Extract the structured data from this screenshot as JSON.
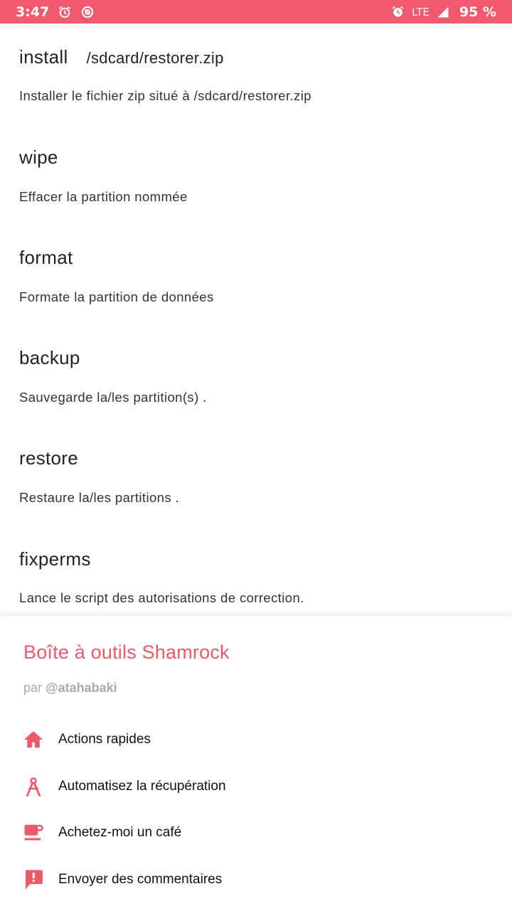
{
  "status_bar": {
    "time": "3:47",
    "network": "LTE",
    "battery": "95 %",
    "left_icons": [
      "alarm-icon",
      "data-saver-icon"
    ],
    "right_icons": [
      "alarm-icon",
      "signal-icon"
    ]
  },
  "commands": [
    {
      "name": "install",
      "arg": "/sdcard/restorer.zip",
      "description": "Installer le fichier zip situé à /sdcard/restorer.zip"
    },
    {
      "name": "wipe",
      "arg": "",
      "description": "Effacer la partition nommée"
    },
    {
      "name": "format",
      "arg": "",
      "description": "Formate la partition de données"
    },
    {
      "name": "backup",
      "arg": "",
      "description": "Sauvegarde la/les partition(s) ."
    },
    {
      "name": "restore",
      "arg": "",
      "description": "Restaure la/les partitions ."
    },
    {
      "name": "fixperms",
      "arg": "",
      "description": "Lance le script des autorisations de correction."
    }
  ],
  "sheet": {
    "title": "Boîte à outils Shamrock",
    "by_prefix": "par",
    "author": "@atahabaki",
    "accent_color": "#ec5a6a",
    "items": [
      {
        "label": "Actions rapides",
        "icon": "home-icon"
      },
      {
        "label": "Automatisez la récupération",
        "icon": "compass-icon"
      },
      {
        "label": "Achetez-moi un café",
        "icon": "coffee-icon"
      },
      {
        "label": "Envoyer des commentaires",
        "icon": "feedback-icon"
      }
    ]
  }
}
